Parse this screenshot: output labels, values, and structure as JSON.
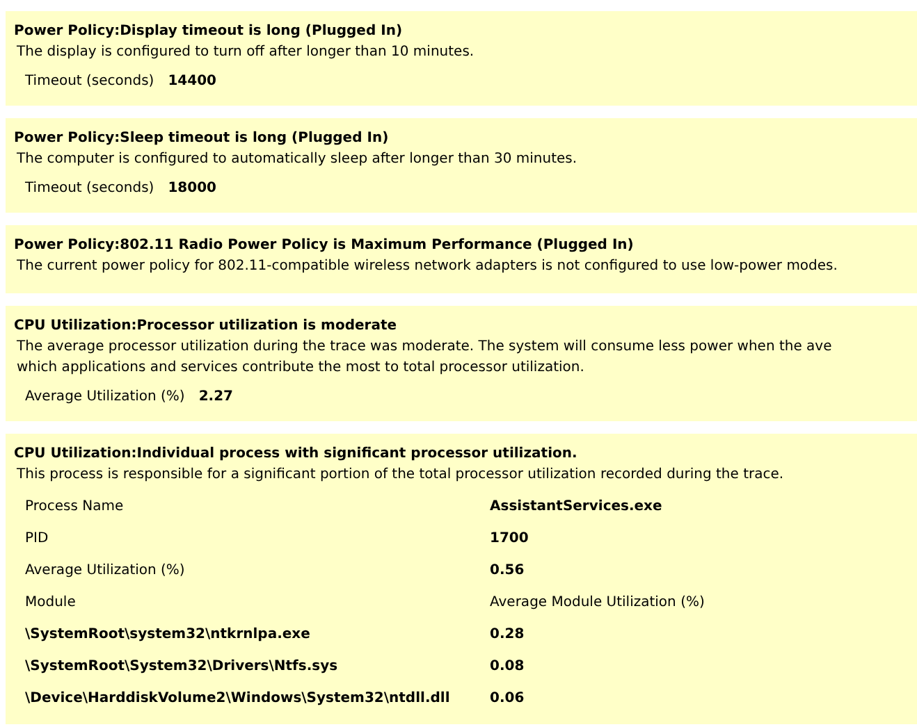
{
  "issues": [
    {
      "title": "Power Policy:Display timeout is long (Plugged In)",
      "description": [
        "The display is configured to turn off after longer than 10 minutes."
      ],
      "properties": [
        {
          "label": "Timeout (seconds)",
          "value": "14400"
        }
      ]
    },
    {
      "title": "Power Policy:Sleep timeout is long (Plugged In)",
      "description": [
        "The computer is configured to automatically sleep after longer than 30 minutes."
      ],
      "properties": [
        {
          "label": "Timeout (seconds)",
          "value": "18000"
        }
      ]
    },
    {
      "title": "Power Policy:802.11 Radio Power Policy is Maximum Performance (Plugged In)",
      "description": [
        "The current power policy for 802.11-compatible wireless network adapters is not configured to use low-power modes."
      ]
    },
    {
      "title": "CPU Utilization:Processor utilization is moderate",
      "description": [
        "The average processor utilization during the trace was moderate. The system will consume less power when the ave",
        "which applications and services contribute the most to total processor utilization."
      ],
      "properties": [
        {
          "label": "Average Utilization (%)",
          "value": "2.27"
        }
      ]
    },
    {
      "title": "CPU Utilization:Individual process with significant processor utilization.",
      "description": [
        "This process is responsible for a significant portion of the total processor utilization recorded during the trace."
      ],
      "table": [
        {
          "kind": "property",
          "cells": [
            "Process Name",
            "AssistantServices.exe"
          ]
        },
        {
          "kind": "property",
          "cells": [
            "PID",
            "1700"
          ]
        },
        {
          "kind": "property",
          "cells": [
            "Average Utilization (%)",
            "0.56"
          ]
        },
        {
          "kind": "header",
          "cells": [
            "Module",
            "Average Module Utilization (%)"
          ]
        },
        {
          "kind": "module",
          "cells": [
            "\\SystemRoot\\system32\\ntkrnlpa.exe",
            "0.28"
          ]
        },
        {
          "kind": "module",
          "cells": [
            "\\SystemRoot\\System32\\Drivers\\Ntfs.sys",
            "0.08"
          ]
        },
        {
          "kind": "module",
          "cells": [
            "\\Device\\HarddiskVolume2\\Windows\\System32\\ntdll.dll",
            "0.06"
          ]
        }
      ]
    }
  ]
}
